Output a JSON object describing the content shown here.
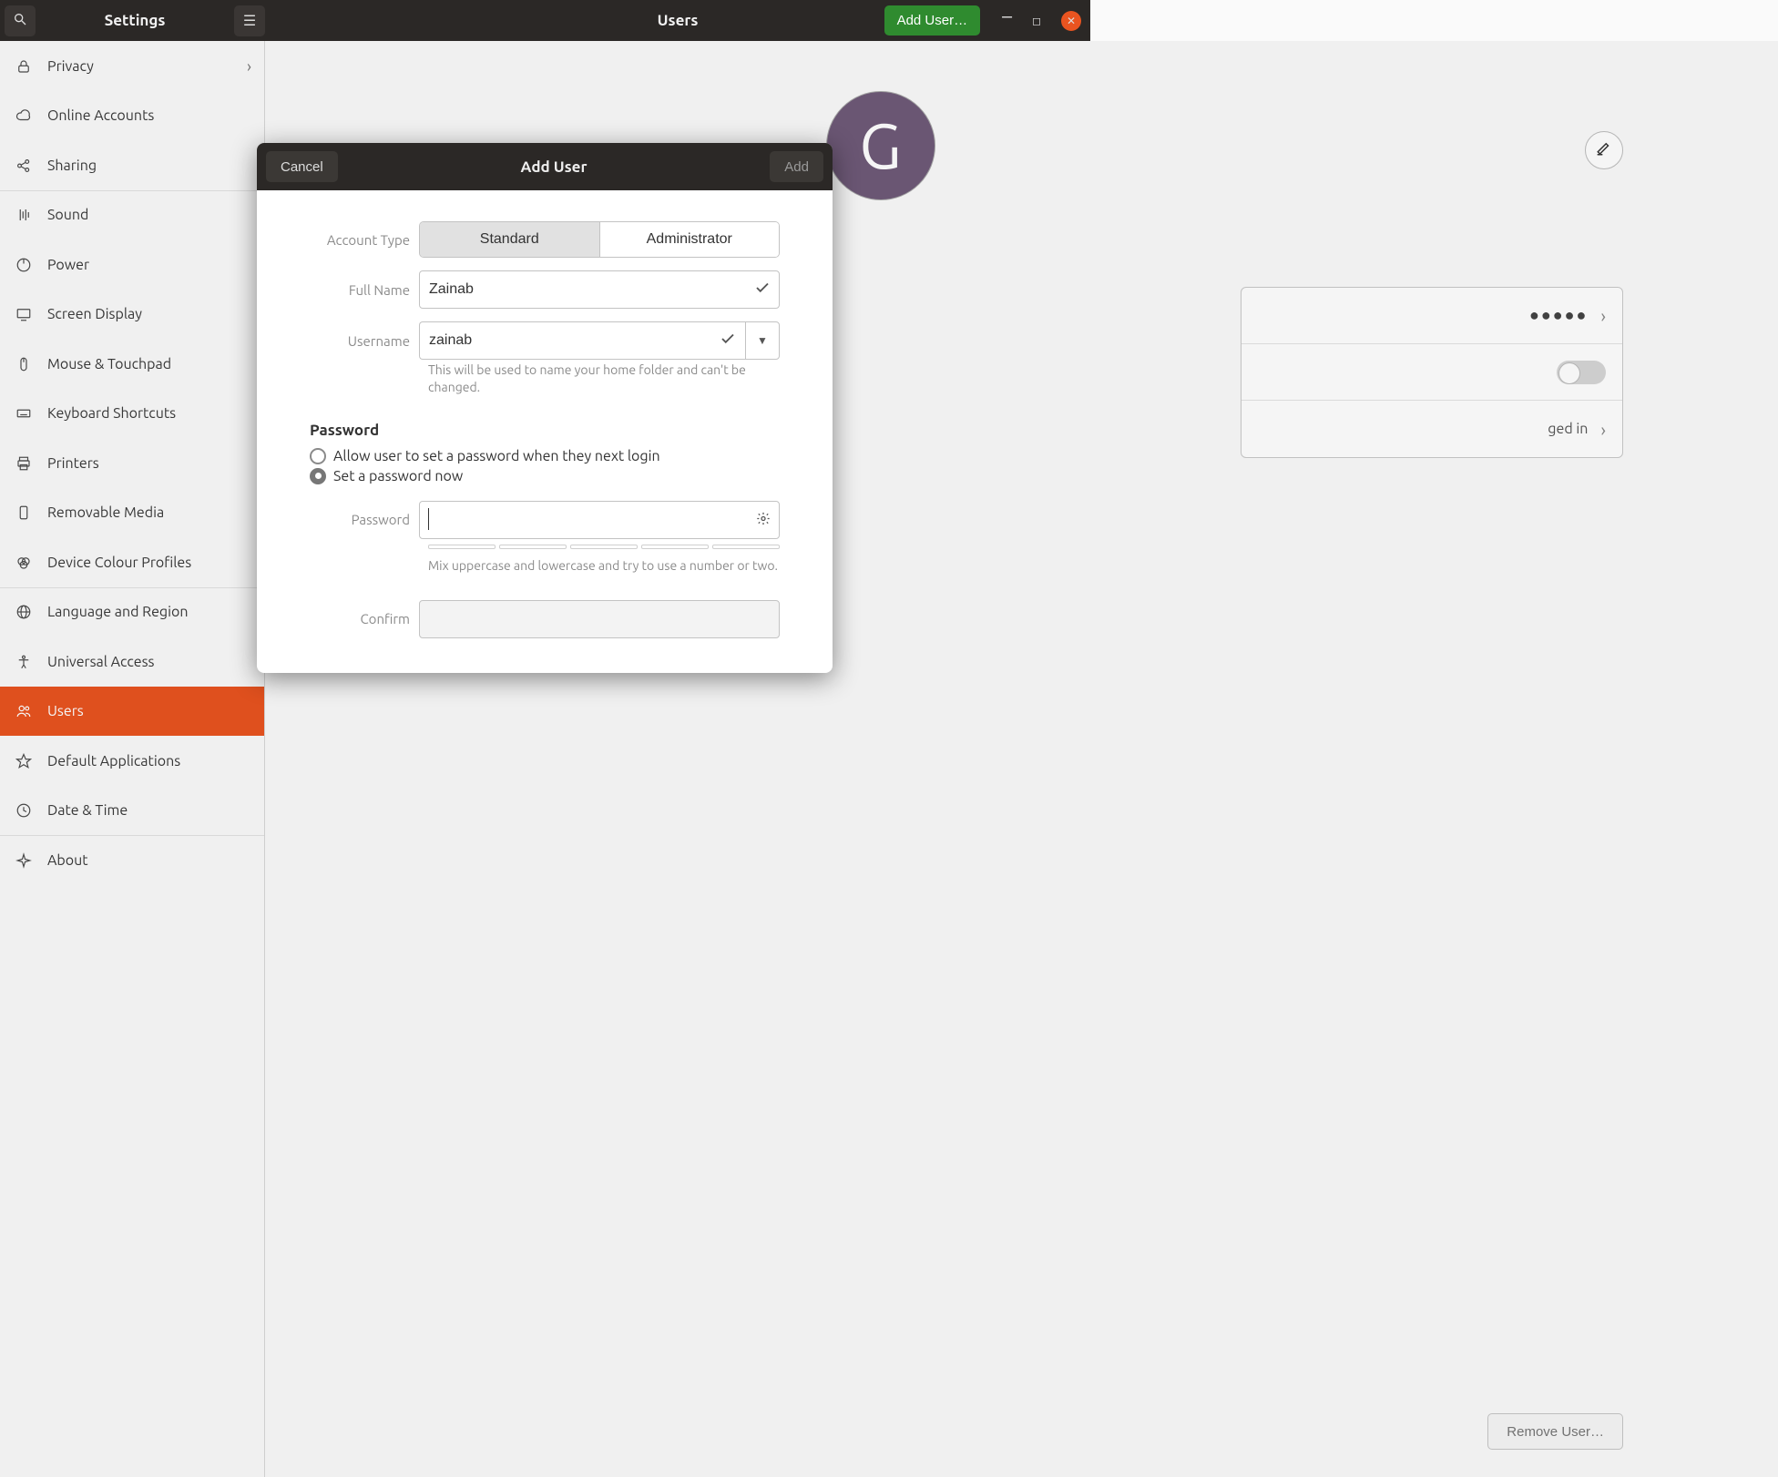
{
  "header": {
    "settings_title": "Settings",
    "page_title": "Users",
    "add_user_btn": "Add User…"
  },
  "sidebar": {
    "items": [
      {
        "label": "Privacy",
        "icon": "lock",
        "chev": true
      },
      {
        "label": "Online Accounts",
        "icon": "cloud"
      },
      {
        "label": "Sharing",
        "icon": "share"
      },
      {
        "label": "Sound",
        "icon": "sound",
        "bt": true
      },
      {
        "label": "Power",
        "icon": "power"
      },
      {
        "label": "Screen Display",
        "icon": "display"
      },
      {
        "label": "Mouse & Touchpad",
        "icon": "mouse"
      },
      {
        "label": "Keyboard Shortcuts",
        "icon": "keyboard"
      },
      {
        "label": "Printers",
        "icon": "printer"
      },
      {
        "label": "Removable Media",
        "icon": "media"
      },
      {
        "label": "Device Colour Profiles",
        "icon": "color"
      },
      {
        "label": "Language and Region",
        "icon": "globe",
        "bt": true
      },
      {
        "label": "Universal Access",
        "icon": "access"
      },
      {
        "label": "Users",
        "icon": "users",
        "active": true
      },
      {
        "label": "Default Applications",
        "icon": "star"
      },
      {
        "label": "Date & Time",
        "icon": "clock"
      },
      {
        "label": "About",
        "icon": "about",
        "bt": true
      }
    ]
  },
  "content": {
    "avatar_letter": "G",
    "account_activity": "ged in",
    "remove_user_btn": "Remove User…",
    "password_dots": "●●●●●"
  },
  "dialog": {
    "cancel": "Cancel",
    "title": "Add User",
    "add": "Add",
    "account_type_label": "Account Type",
    "standard": "Standard",
    "administrator": "Administrator",
    "full_name_label": "Full Name",
    "full_name_value": "Zainab",
    "username_label": "Username",
    "username_value": "zainab",
    "username_hint": "This will be used to name your home folder and can't be changed.",
    "password_section": "Password",
    "radio_later": "Allow user to set a password when they next login",
    "radio_now": "Set a password now",
    "password_label": "Password",
    "password_value": "",
    "password_hint": "Mix uppercase and lowercase and try to use a number or two.",
    "confirm_label": "Confirm",
    "confirm_value": ""
  }
}
